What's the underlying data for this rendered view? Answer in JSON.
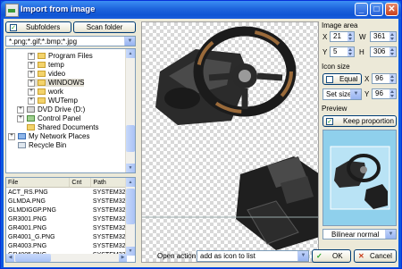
{
  "window": {
    "title": "Import from image",
    "min_label": "_",
    "max_label": "□",
    "close_label": "✕"
  },
  "top_left": {
    "subfolders_checked": true,
    "subfolders_label": "Subfolders",
    "scan_folder_label": "Scan folder",
    "filter_value": "*.png;*.gif;*.bmp;*.jpg"
  },
  "tree": [
    {
      "label": "Program Files",
      "expander": "+",
      "icon": "folder-icon"
    },
    {
      "label": "temp",
      "expander": "+",
      "icon": "folder-icon"
    },
    {
      "label": "video",
      "expander": "+",
      "icon": "folder-icon"
    },
    {
      "label": "WINDOWS",
      "expander": "+",
      "icon": "folder-icon",
      "selected": true
    },
    {
      "label": "work",
      "expander": "+",
      "icon": "folder-icon"
    },
    {
      "label": "WUTemp",
      "expander": "+",
      "icon": "folder-icon"
    },
    {
      "label": "DVD Drive (D:)",
      "expander": "+",
      "icon": "dvd-drive-icon"
    },
    {
      "label": "Control Panel",
      "expander": "+",
      "icon": "control-panel-icon"
    },
    {
      "label": "Shared Documents",
      "expander": "",
      "icon": "folder-icon"
    },
    {
      "label": "My Network Places",
      "expander": "+",
      "icon": "network-places-icon"
    },
    {
      "label": "Recycle Bin",
      "expander": "",
      "icon": "recycle-bin-icon"
    }
  ],
  "file_list": {
    "columns": [
      "File",
      "Cnt",
      "Path"
    ],
    "rows": [
      {
        "file": "ACT_RS.PNG",
        "cnt": "",
        "path": "SYSTEM32"
      },
      {
        "file": "GLMDA.PNG",
        "cnt": "",
        "path": "SYSTEM32"
      },
      {
        "file": "GLMDIGGP.PNG",
        "cnt": "",
        "path": "SYSTEM32"
      },
      {
        "file": "GR3001.PNG",
        "cnt": "",
        "path": "SYSTEM32"
      },
      {
        "file": "GR4001.PNG",
        "cnt": "",
        "path": "SYSTEM32"
      },
      {
        "file": "GR4001_G.PNG",
        "cnt": "",
        "path": "SYSTEM32"
      },
      {
        "file": "GR4003.PNG",
        "cnt": "",
        "path": "SYSTEM32"
      },
      {
        "file": "GR4005.PNG",
        "cnt": "",
        "path": "SYSTEM32"
      }
    ]
  },
  "image_area": {
    "title": "Image area",
    "x_label": "X",
    "x": "21",
    "w_label": "W",
    "w": "361",
    "y_label": "Y",
    "y": "5",
    "h_label": "H",
    "h": "306"
  },
  "icon_size": {
    "title": "Icon size",
    "equal_label": "Equal",
    "x_label": "X",
    "x": "96",
    "set_size_label": "Set size",
    "y_label": "Y",
    "y": "96"
  },
  "preview": {
    "title": "Preview",
    "keep_proportion_label": "Keep proportion",
    "keep_proportion_checked": true,
    "filter_value": "Bilinear normal"
  },
  "bottom": {
    "open_action_label": "Open action",
    "open_action_value": "add as icon to list",
    "ok_label": "OK",
    "cancel_label": "Cancel"
  },
  "colors": {
    "title_bar": "#1e64dc",
    "client": "#ece9d8",
    "preview_bg": "#8fd0ec",
    "ok_check": "#21a121",
    "cancel_x": "#c8401d"
  }
}
